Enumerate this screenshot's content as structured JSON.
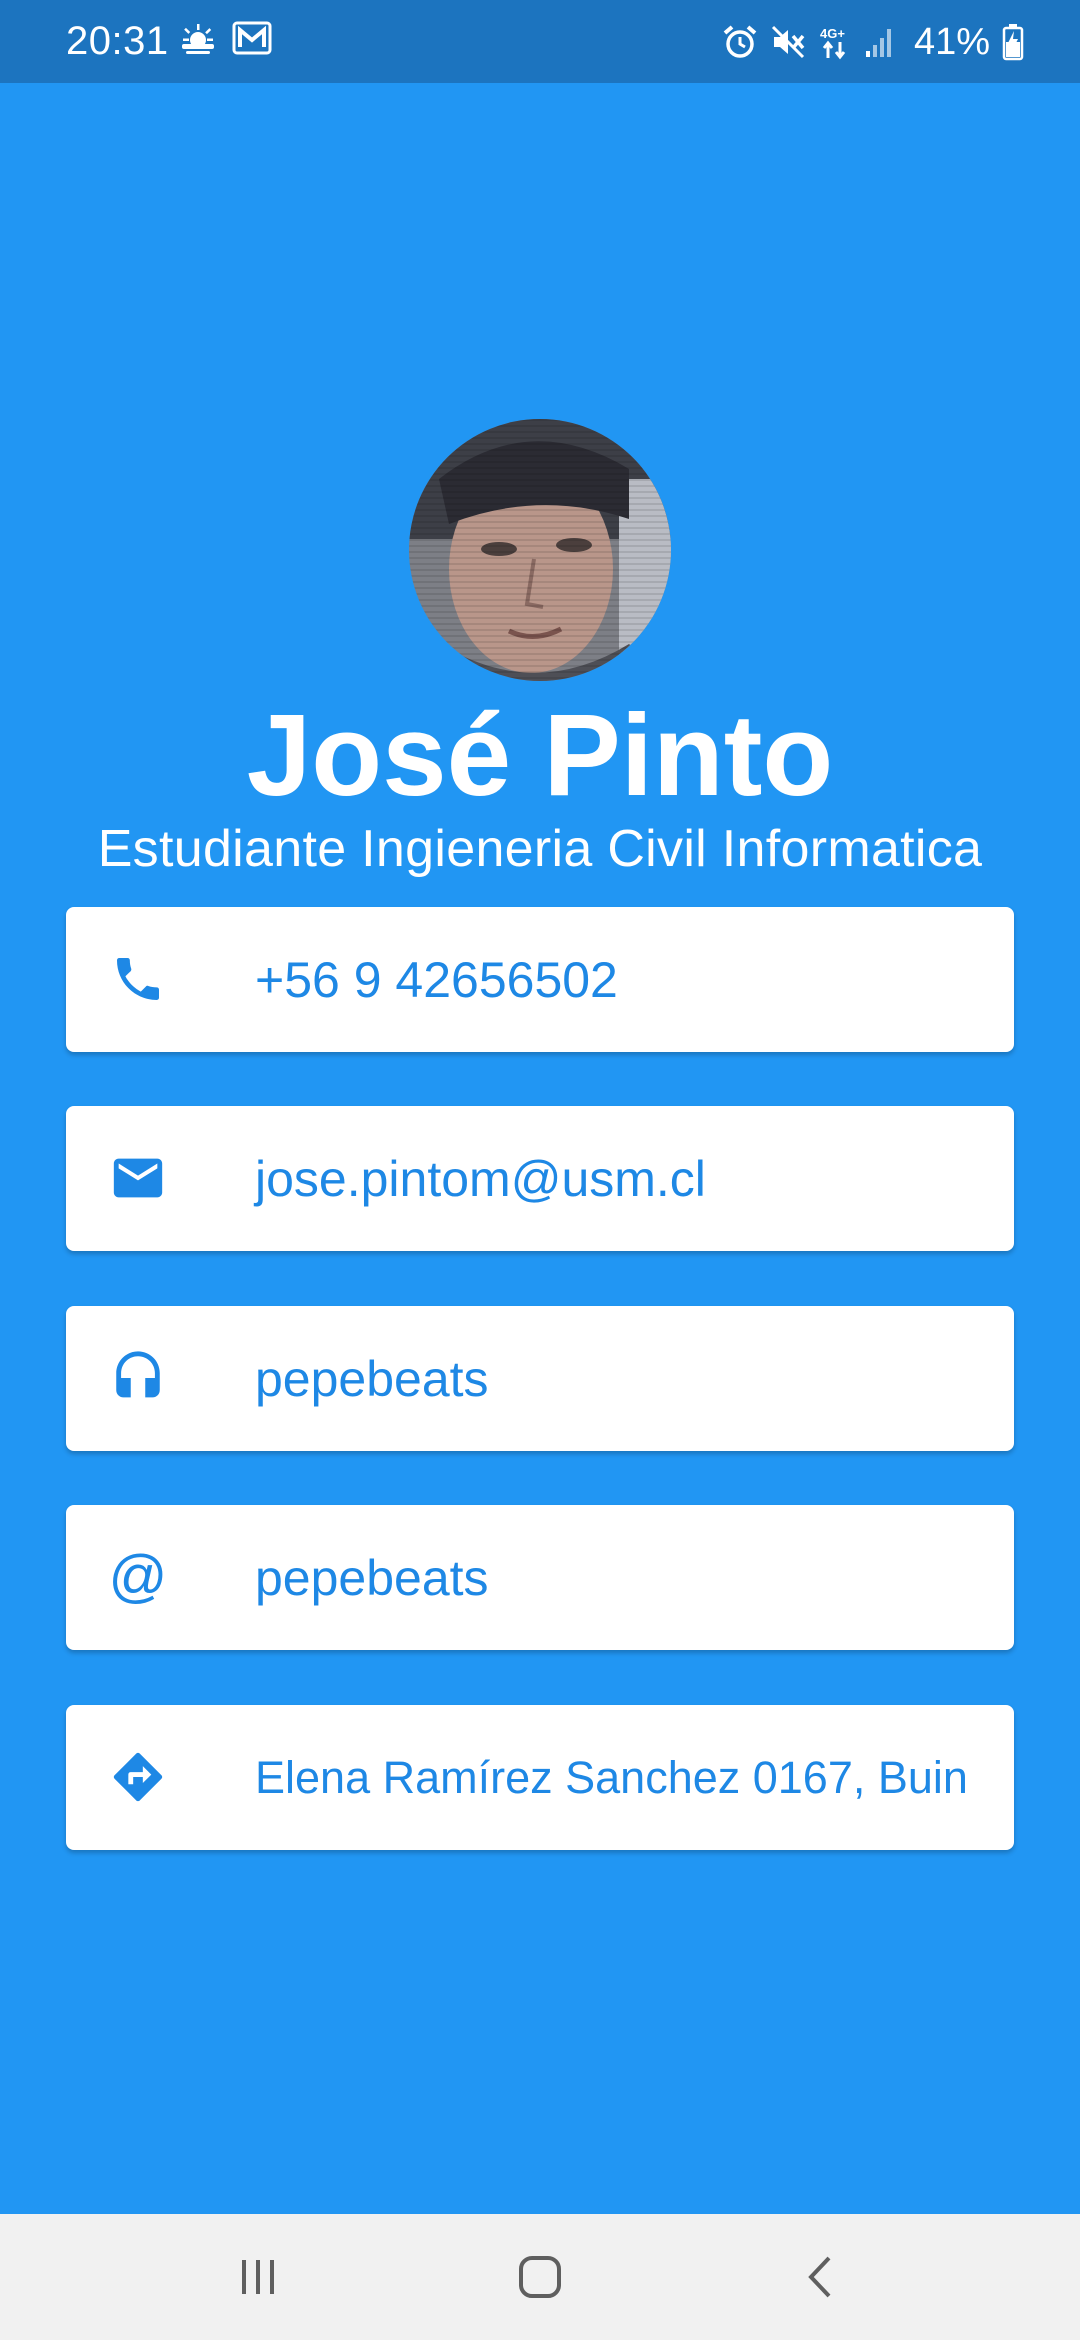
{
  "status_bar": {
    "time": "20:31",
    "battery": "41%"
  },
  "profile": {
    "name": "José Pinto",
    "title": "Estudiante Ingieneria Civil Informatica"
  },
  "contacts": [
    {
      "icon": "phone-icon",
      "text": "+56 9 42656502"
    },
    {
      "icon": "email-icon",
      "text": "jose.pintom@usm.cl"
    },
    {
      "icon": "headphones-icon",
      "text": "pepebeats"
    },
    {
      "icon": "at-icon",
      "text": "pepebeats"
    },
    {
      "icon": "directions-icon",
      "text": "Elena Ramírez Sanchez 0167, Buin"
    }
  ],
  "colors": {
    "background": "#2196f3",
    "status_bar": "#1c74bf",
    "accent": "#1e88e5",
    "card": "#ffffff",
    "nav_bar": "#f1f1f1"
  }
}
